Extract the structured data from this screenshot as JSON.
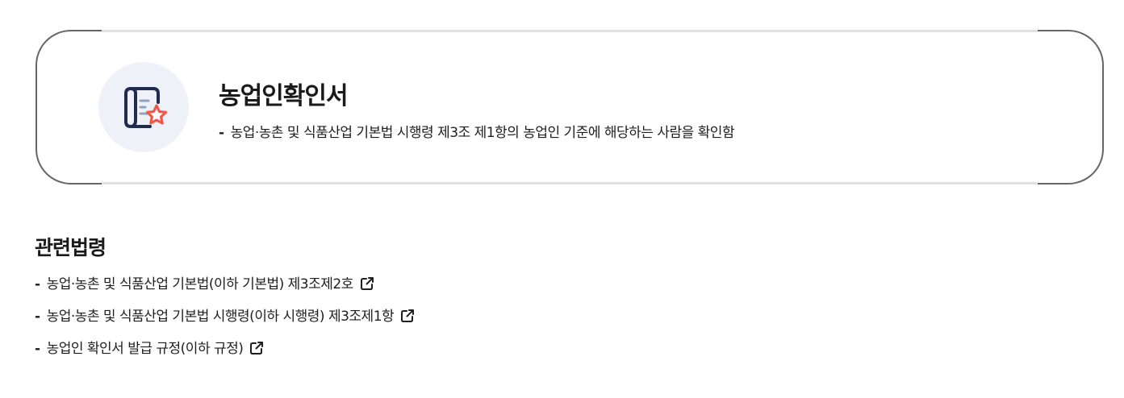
{
  "summary": {
    "icon": "document-star-icon",
    "title": "농업인확인서",
    "description_bullet": "-",
    "description": "농업·농촌 및 식품산업 기본법 시행령 제3조 제1항의 농업인 기준에 해당하는 사람을 확인함"
  },
  "related_laws": {
    "heading": "관련법령",
    "bullet": "-",
    "link_icon": "external-link-icon",
    "items": [
      {
        "label": "농업·농촌 및 식품산업 기본법(이하 기본법) 제3조제2호"
      },
      {
        "label": "농업·농촌 및 식품산업 기본법 시행령(이하 시행령) 제3조제1항"
      },
      {
        "label": "농업인 확인서 발급 규정(이하 규정)"
      }
    ]
  },
  "colors": {
    "icon_navy": "#1e2d4f",
    "icon_accent": "#f0584a",
    "icon_bg": "#eef2f8",
    "frame": "#666666",
    "line": "#e0e0e0"
  }
}
